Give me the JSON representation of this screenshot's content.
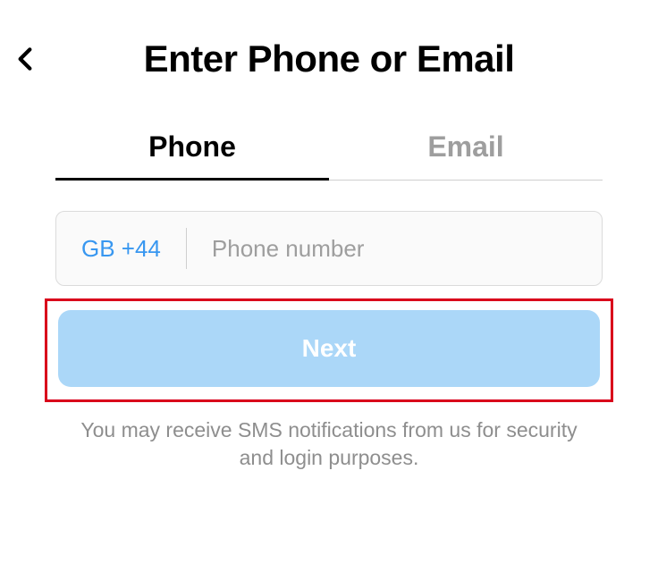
{
  "header": {
    "title": "Enter Phone or Email"
  },
  "tabs": {
    "phone": "Phone",
    "email": "Email"
  },
  "input": {
    "country_code": "GB +44",
    "placeholder": "Phone number",
    "value": ""
  },
  "button": {
    "next": "Next"
  },
  "disclaimer": "You may receive SMS notifications from us for security and login purposes."
}
